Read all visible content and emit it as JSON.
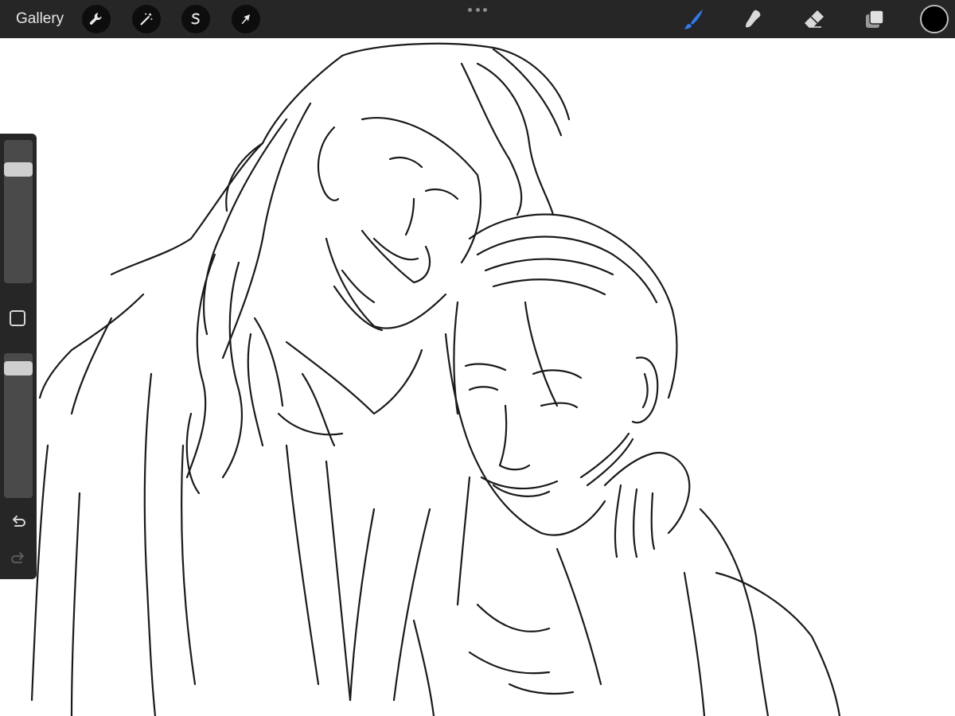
{
  "toolbar": {
    "gallery_label": "Gallery",
    "left_tools": [
      "wrench-icon",
      "magic-wand-icon",
      "selection-icon",
      "transform-arrow-icon"
    ],
    "right_tools": [
      "brush-icon",
      "smudge-icon",
      "eraser-icon",
      "layers-icon"
    ],
    "active_tool": "brush-icon",
    "active_color": "#2f7cf6",
    "current_color": "#000000"
  },
  "sidebar": {
    "brush_size_level": 0.83,
    "opacity_level": 0.94,
    "icons": [
      "modify-square-icon",
      "undo-icon",
      "redo-icon"
    ]
  }
}
